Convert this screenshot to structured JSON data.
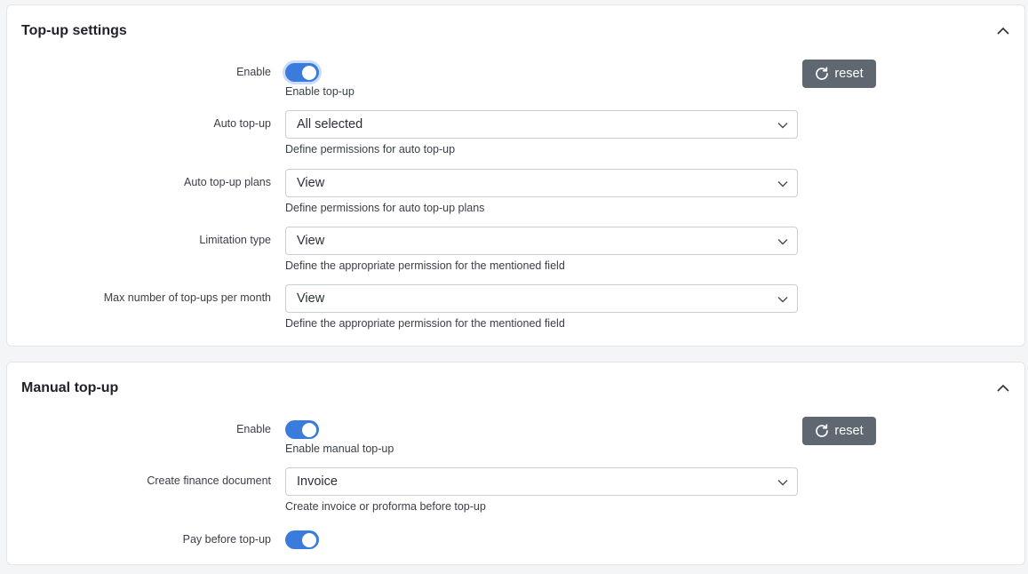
{
  "topup_settings": {
    "title": "Top-up settings",
    "reset_label": "reset",
    "enable": {
      "label": "Enable",
      "checked": true,
      "help": "Enable top-up"
    },
    "auto_topup": {
      "label": "Auto top-up",
      "value": "All selected",
      "help": "Define permissions for auto top-up"
    },
    "auto_topup_plans": {
      "label": "Auto top-up plans",
      "value": "View",
      "help": "Define permissions for auto top-up plans"
    },
    "limitation_type": {
      "label": "Limitation type",
      "value": "View",
      "help": "Define the appropriate permission for the mentioned field"
    },
    "max_topups": {
      "label": "Max number of top-ups per month",
      "value": "View",
      "help": "Define the appropriate permission for the mentioned field"
    }
  },
  "manual_topup": {
    "title": "Manual top-up",
    "reset_label": "reset",
    "enable": {
      "label": "Enable",
      "checked": true,
      "help": "Enable manual top-up"
    },
    "finance_document": {
      "label": "Create finance document",
      "value": "Invoice",
      "help": "Create invoice or proforma before top-up"
    },
    "pay_before": {
      "label": "Pay before top-up",
      "checked": true
    }
  },
  "colors": {
    "toggle_on": "#3a7bdb",
    "reset_button": "#5f6870",
    "card_border": "#e3e5e9"
  },
  "icons": {
    "collapse": "chevron-up-icon",
    "dropdown": "chevron-down-icon",
    "reset": "refresh-icon"
  }
}
